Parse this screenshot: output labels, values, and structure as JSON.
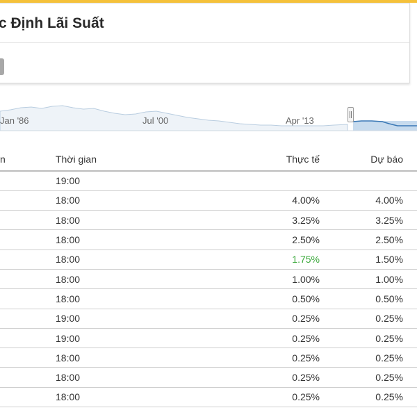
{
  "header": {
    "title": "c Định Lãi Suất",
    "accent_color": "#f5c13a"
  },
  "navigator": {
    "labels": [
      "Jan '86",
      "Jul '00",
      "Apr '13"
    ],
    "line_color": "#b9cde0",
    "selected_fill": "#c7dbee",
    "selected_line": "#3a78b5"
  },
  "table": {
    "headers": {
      "date": "n",
      "time": "Thời gian",
      "actual": "Thực tế",
      "forecast": "Dự báo"
    },
    "rows": [
      {
        "time": "19:00",
        "actual": "",
        "forecast": "",
        "actual_status": "neutral"
      },
      {
        "time": "18:00",
        "actual": "4.00%",
        "forecast": "4.00%",
        "actual_status": "neutral"
      },
      {
        "time": "18:00",
        "actual": "3.25%",
        "forecast": "3.25%",
        "actual_status": "neutral"
      },
      {
        "time": "18:00",
        "actual": "2.50%",
        "forecast": "2.50%",
        "actual_status": "neutral"
      },
      {
        "time": "18:00",
        "actual": "1.75%",
        "forecast": "1.50%",
        "actual_status": "positive"
      },
      {
        "time": "18:00",
        "actual": "1.00%",
        "forecast": "1.00%",
        "actual_status": "neutral"
      },
      {
        "time": "18:00",
        "actual": "0.50%",
        "forecast": "0.50%",
        "actual_status": "neutral"
      },
      {
        "time": "19:00",
        "actual": "0.25%",
        "forecast": "0.25%",
        "actual_status": "neutral"
      },
      {
        "time": "19:00",
        "actual": "0.25%",
        "forecast": "0.25%",
        "actual_status": "neutral"
      },
      {
        "time": "18:00",
        "actual": "0.25%",
        "forecast": "0.25%",
        "actual_status": "neutral"
      },
      {
        "time": "18:00",
        "actual": "0.25%",
        "forecast": "0.25%",
        "actual_status": "neutral"
      },
      {
        "time": "18:00",
        "actual": "0.25%",
        "forecast": "0.25%",
        "actual_status": "neutral"
      }
    ],
    "positive_color": "#3aa83a"
  }
}
